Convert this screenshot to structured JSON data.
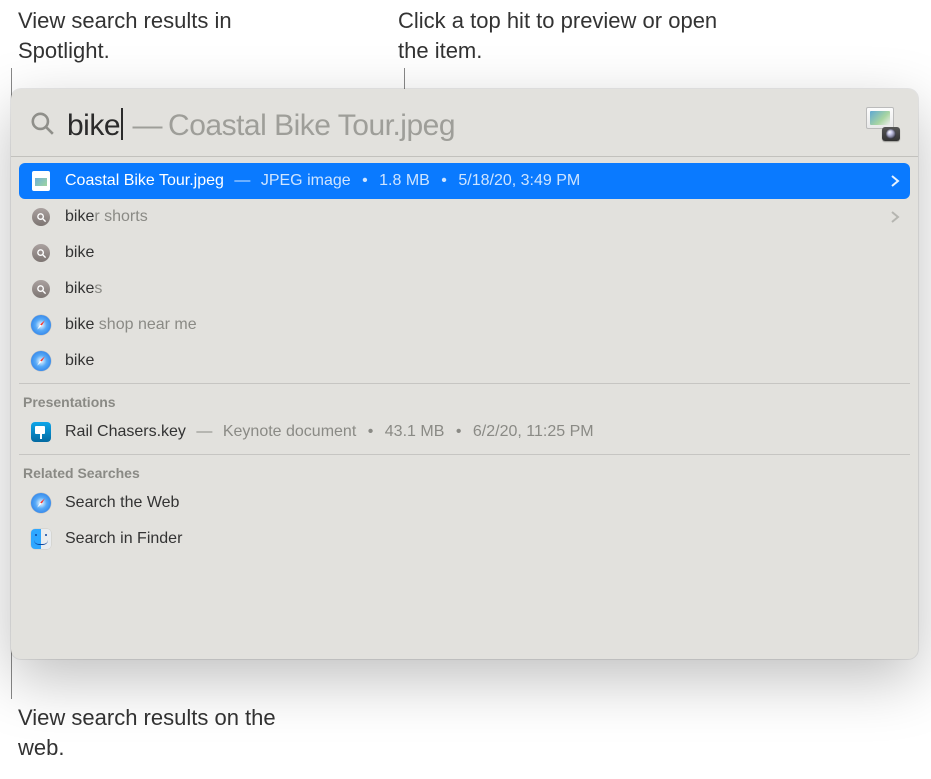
{
  "callouts": {
    "top_left": "View search results in Spotlight.",
    "top_right": "Click a top hit to preview or open the item.",
    "bottom_left": "View search results on the web."
  },
  "search": {
    "query": "bike",
    "completion": "Coastal Bike Tour.jpeg"
  },
  "top_hit": {
    "name": "Coastal Bike Tour.jpeg",
    "kind": "JPEG image",
    "size": "1.8 MB",
    "date": "5/18/20, 3:49 PM",
    "icon": "file-icon"
  },
  "suggestions": [
    {
      "typed": "bike",
      "rest": "r shorts",
      "icon": "magnifier",
      "chevron": true
    },
    {
      "typed": "bike",
      "rest": "",
      "icon": "magnifier",
      "chevron": false
    },
    {
      "typed": "bike",
      "rest": "s",
      "icon": "magnifier",
      "chevron": false
    },
    {
      "typed": "bike",
      "rest": " shop near me",
      "icon": "safari",
      "chevron": false
    },
    {
      "typed": "bike",
      "rest": "",
      "icon": "safari",
      "chevron": false
    }
  ],
  "sections": [
    {
      "title": "Presentations",
      "items": [
        {
          "name": "Rail Chasers.key",
          "kind": "Keynote document",
          "size": "43.1 MB",
          "date": "6/2/20, 11:25 PM",
          "icon": "keynote"
        }
      ]
    },
    {
      "title": "Related Searches",
      "items": [
        {
          "name": "Search the Web",
          "icon": "safari"
        },
        {
          "name": "Search in Finder",
          "icon": "finder"
        }
      ]
    }
  ]
}
